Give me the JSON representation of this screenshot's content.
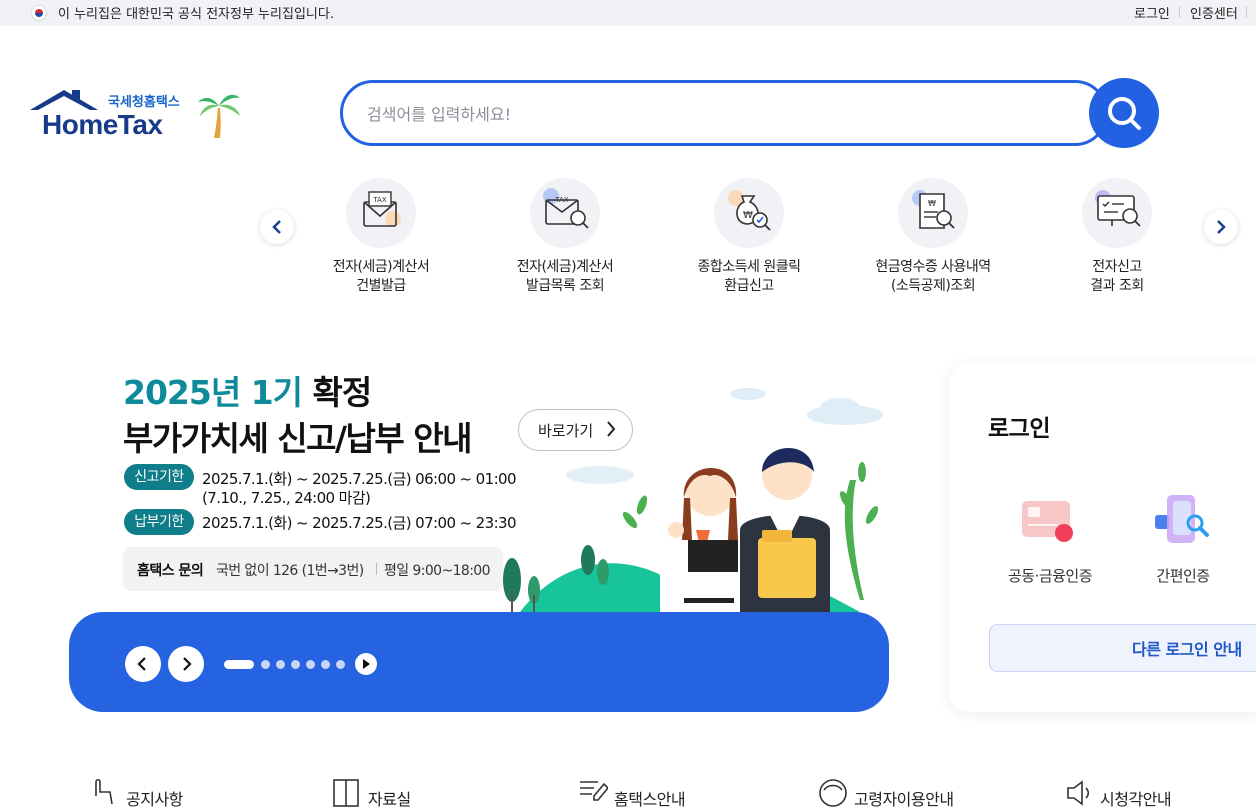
{
  "gov_bar": {
    "notice": "이 누리집은 대한민국 공식 전자정부 누리집입니다.",
    "login": "로그인",
    "cert_center": "인증센터"
  },
  "logo": {
    "sub": "국세청홈택스",
    "main": "HomeTax"
  },
  "search": {
    "placeholder": "검색어를 입력하세요!"
  },
  "quick_menu": [
    {
      "line1": "전자(세금)계산서",
      "line2": "건별발급",
      "icon": "tax-invoice-envelope-icon"
    },
    {
      "line1": "전자(세금)계산서",
      "line2": "발급목록 조회",
      "icon": "tax-invoice-search-icon"
    },
    {
      "line1": "종합소득세 원클릭",
      "line2": "환급신고",
      "icon": "money-bag-refund-icon"
    },
    {
      "line1": "현금영수증 사용내역",
      "line2": "(소득공제)조회",
      "icon": "receipt-search-icon"
    },
    {
      "line1": "전자신고",
      "line2": "결과 조회",
      "icon": "monitor-search-icon"
    }
  ],
  "banner": {
    "title_highlight": "2025년 1기",
    "title_rest": " 확정",
    "title_line2": "부가가치세 신고/납부 안내",
    "go_label": "바로가기",
    "report_badge": "신고기한",
    "report_period": "2025.7.1.(화) ~ 2025.7.25.(금) 06:00 ~ 01:00",
    "report_note": "(7.10., 7.25., 24:00 마감)",
    "pay_badge": "납부기한",
    "pay_period": "2025.7.1.(화) ~ 2025.7.25.(금) 07:00 ~ 23:30",
    "contact_title": "홈택스 문의",
    "contact_phone": "국번 없이 126 (1번→3번)",
    "contact_hours": "평일 9:00~18:00",
    "slide_count": 7,
    "active_slide": 1
  },
  "login_card": {
    "title": "로그인",
    "option_joint": "공동·금융인증",
    "option_simple": "간편인증",
    "other_login": "다른 로그인 안내"
  },
  "bottom_menu": [
    "공지사항",
    "자료실",
    "홈택스안내",
    "고령자이용안내",
    "시청각안내"
  ],
  "colors": {
    "primary_blue": "#2361e3",
    "banner_teal": "#0f8a9a",
    "logo_navy": "#173a8a"
  }
}
